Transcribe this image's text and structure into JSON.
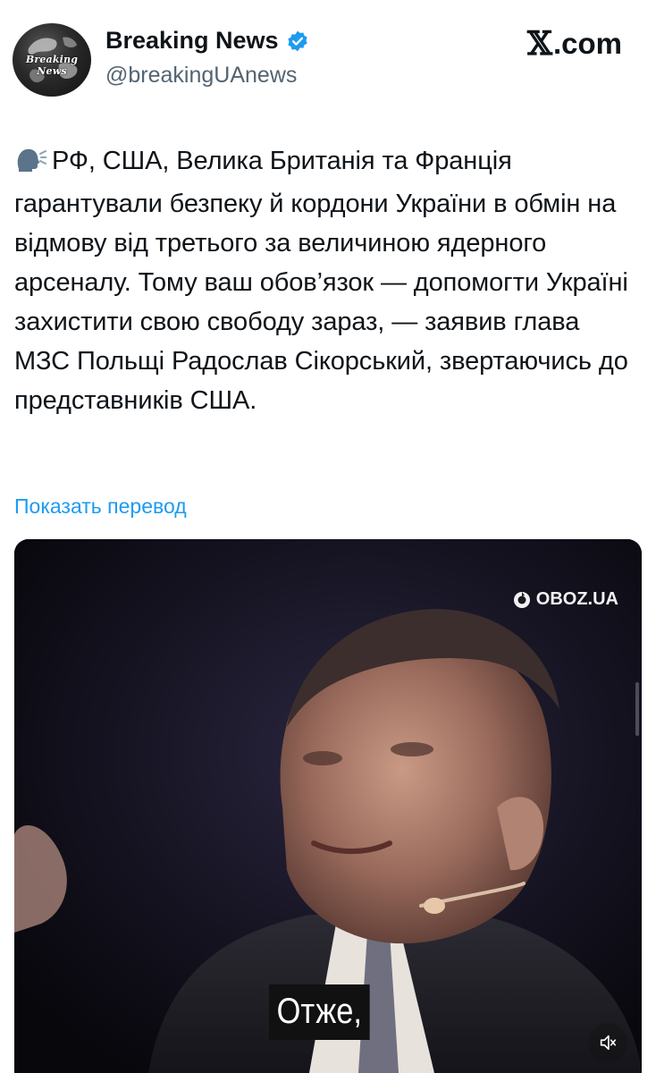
{
  "header": {
    "avatar_text": "Breaking News",
    "display_name": "Breaking News",
    "handle": "@breakingUAnews",
    "brand": "𝕏.com",
    "brand_mark": "𝕏",
    "brand_suffix": ".com"
  },
  "tweet": {
    "emoji_icon": "speaking-head-icon",
    "text": "РФ, США, Велика Британія та Франція гарантували безпеку й кордони України в обмін на відмову від третього за величиною ядерного арсеналу. Тому ваш обов’язок — допомогти Україні захистити свою свободу зараз, — заявив глава МЗС Польщі Радослав Сікорський, звертаючись до представників США.",
    "translate_label": "Показать перевод"
  },
  "video": {
    "watermark": "OBOZ.UA",
    "subtitle": "Отже,"
  },
  "colors": {
    "verified": "#1d9bf0",
    "link": "#1d9bf0",
    "handle": "#536471"
  }
}
